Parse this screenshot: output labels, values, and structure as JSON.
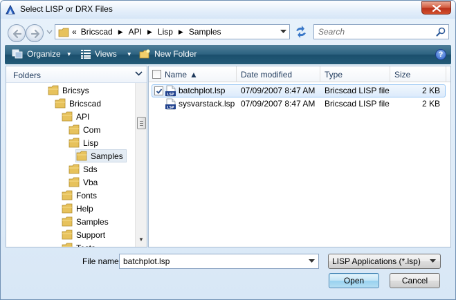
{
  "window": {
    "title": "Select LISP or DRX Files",
    "close_label": "×"
  },
  "address": {
    "overflow": "«",
    "crumbs": [
      "Bricscad",
      "API",
      "Lisp",
      "Samples"
    ],
    "separator": "▶"
  },
  "search": {
    "placeholder": "Search"
  },
  "toolbar": {
    "organize": "Organize",
    "views": "Views",
    "new_folder": "New Folder",
    "help": "?"
  },
  "nav": {
    "header": "Folders",
    "tree": [
      {
        "label": "Bricsys",
        "depth": 0,
        "selected": false
      },
      {
        "label": "Bricscad",
        "depth": 1,
        "selected": false
      },
      {
        "label": "API",
        "depth": 2,
        "selected": false
      },
      {
        "label": "Com",
        "depth": 3,
        "selected": false
      },
      {
        "label": "Lisp",
        "depth": 3,
        "selected": false
      },
      {
        "label": "Samples",
        "depth": 4,
        "selected": true
      },
      {
        "label": "Sds",
        "depth": 3,
        "selected": false
      },
      {
        "label": "Vba",
        "depth": 3,
        "selected": false
      },
      {
        "label": "Fonts",
        "depth": 2,
        "selected": false
      },
      {
        "label": "Help",
        "depth": 2,
        "selected": false
      },
      {
        "label": "Samples",
        "depth": 2,
        "selected": false
      },
      {
        "label": "Support",
        "depth": 2,
        "selected": false
      },
      {
        "label": "Tests",
        "depth": 2,
        "selected": false
      }
    ]
  },
  "columns": {
    "name": "Name",
    "date": "Date modified",
    "type": "Type",
    "size": "Size"
  },
  "files": [
    {
      "name": "batchplot.lsp",
      "date": "07/09/2007 8:47 AM",
      "type": "Bricscad LISP file",
      "size": "2 KB",
      "selected": true,
      "checked": true
    },
    {
      "name": "sysvarstack.lsp",
      "date": "07/09/2007 8:47 AM",
      "type": "Bricscad LISP file",
      "size": "2 KB",
      "selected": false,
      "checked": false
    }
  ],
  "footer": {
    "file_name_label": "File name:",
    "file_name_value": "batchplot.lsp",
    "file_type": "LISP Applications (*.lsp)",
    "open_label": "Open",
    "cancel_label": "Cancel"
  },
  "colors": {
    "command_bar": "#245b78",
    "selection": "#dcebfc",
    "folder": "#e7c25c"
  }
}
